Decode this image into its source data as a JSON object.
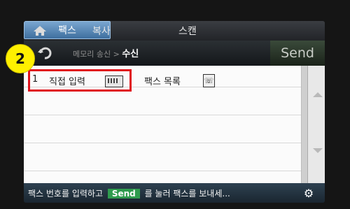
{
  "tabs": {
    "copy": "복사",
    "scan": "스캔",
    "fax": "팩스"
  },
  "header": {
    "crumb_prefix": "메모리 송신 > ",
    "crumb_current": "수신",
    "send_label": "Send"
  },
  "list": {
    "item_number": "1",
    "direct_input": "직접 입력",
    "fax_list": "팩스 목록"
  },
  "status": {
    "text_before": "팩스 번호를 입력하고",
    "send_badge": "Send",
    "text_after": "를 눌러 팩스를 보내세..."
  },
  "callout_label": "2",
  "colors": {
    "highlight": "#e0131c",
    "fax_tab": "#5b8cbc",
    "send_badge": "#2f9b4e",
    "callout": "#fff000"
  }
}
